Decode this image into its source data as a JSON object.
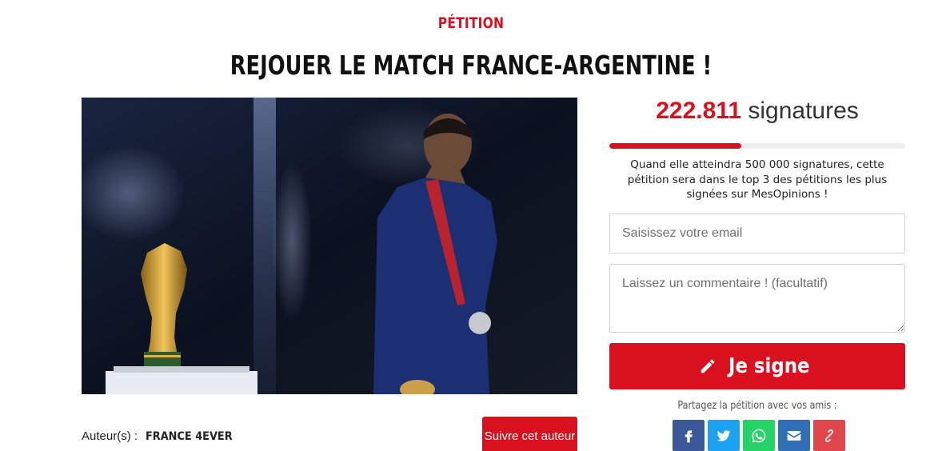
{
  "header": {
    "kicker": "PÉTITION",
    "title": "REJOUER LE MATCH FRANCE-ARGENTINE !"
  },
  "petition": {
    "signature_count": "222.811",
    "signature_unit": "signatures",
    "progress_fraction": 0.445,
    "goal_text": "Quand elle atteindra 500 000 signatures, cette pétition sera dans le top 3 des pétitions les plus signées sur MesOpinions !"
  },
  "form": {
    "email_placeholder": "Saisissez votre email",
    "comment_placeholder": "Laissez un commentaire ! (facultatif)",
    "sign_label": "Je signe",
    "sign_icon": "pencil-icon"
  },
  "share": {
    "label": "Partagez la pétition avec vos amis :",
    "buttons": [
      {
        "icon": "facebook-icon",
        "color": "#3b5998"
      },
      {
        "icon": "twitter-icon",
        "color": "#1da1f2"
      },
      {
        "icon": "whatsapp-icon",
        "color": "#25d366"
      },
      {
        "icon": "email-icon",
        "color": "#2f6fb6"
      },
      {
        "icon": "link-icon",
        "color": "#e0474c"
      }
    ]
  },
  "author": {
    "label": "Auteur(s) :",
    "name": "FRANCE 4EVER",
    "follow_label": "Suivre cet auteur"
  },
  "colors": {
    "accent": "#d9101e",
    "text": "#222222"
  }
}
